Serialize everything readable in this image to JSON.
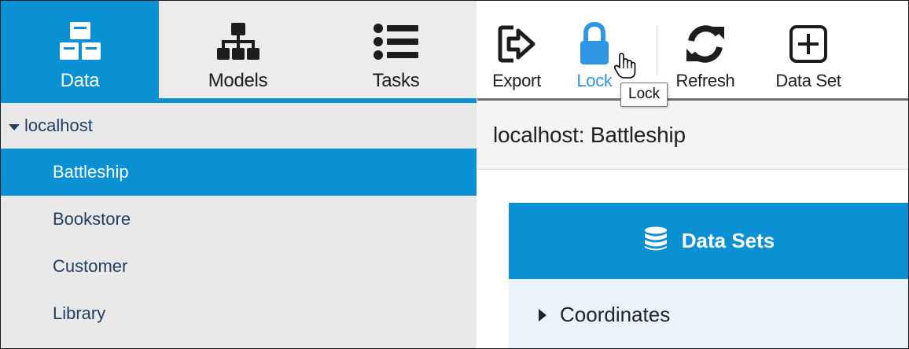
{
  "nav": {
    "tabs": [
      {
        "label": "Data",
        "icon": "cubes-icon",
        "active": true
      },
      {
        "label": "Models",
        "icon": "sitemap-icon",
        "active": false
      },
      {
        "label": "Tasks",
        "icon": "list-icon",
        "active": false
      }
    ]
  },
  "toolbar": {
    "export_label": "Export",
    "lock_label": "Lock",
    "refresh_label": "Refresh",
    "dataset_label": "Data Set",
    "tooltip": "Lock"
  },
  "sidebar": {
    "root": "localhost",
    "items": [
      {
        "label": "Battleship",
        "selected": true
      },
      {
        "label": "Bookstore",
        "selected": false
      },
      {
        "label": "Customer",
        "selected": false
      },
      {
        "label": "Library",
        "selected": false
      }
    ]
  },
  "main": {
    "title": "localhost: Battleship",
    "panel_title": "Data Sets",
    "rows": [
      {
        "label": "Coordinates"
      }
    ]
  },
  "colors": {
    "accent": "#0a91d4",
    "lock_active": "#2f96e4",
    "sidebar_bg": "#e9e9e9",
    "panel_bg": "#eaf3fb"
  }
}
